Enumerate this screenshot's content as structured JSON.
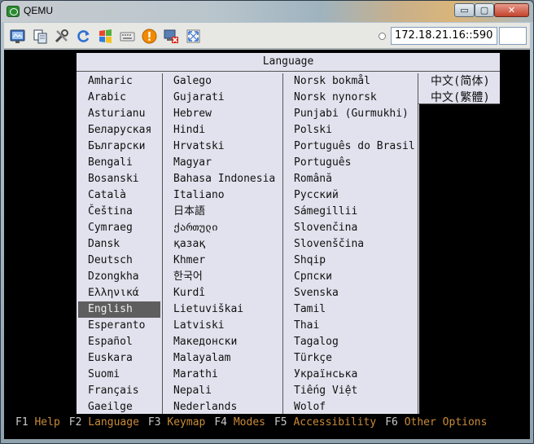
{
  "window": {
    "title": "QEMU",
    "controls": {
      "minimize": "▭",
      "maximize": "▢",
      "close": "✕"
    }
  },
  "toolbar": {
    "icons": [
      "monitor-icon",
      "copy-icon",
      "tools-icon",
      "refresh-icon",
      "windows-flag-icon",
      "keyboard-icon",
      "alert-icon",
      "disconnect-icon",
      "fullscreen-icon"
    ],
    "address": "172.18.21.16::590",
    "colors": {
      "alert": "#f28a00",
      "refresh": "#2f6fd1"
    }
  },
  "dialog": {
    "title": "Language",
    "columns": [
      [
        "Amharic",
        "Arabic",
        "Asturianu",
        "Беларуская",
        "Български",
        "Bengali",
        "Bosanski",
        "Català",
        "Čeština",
        "Cymraeg",
        "Dansk",
        "Deutsch",
        "Dzongkha",
        "Ελληνικά",
        "English",
        "Esperanto",
        "Español",
        "Euskara",
        "Suomi",
        "Français",
        "Gaeilge"
      ],
      [
        "Galego",
        "Gujarati",
        "Hebrew",
        "Hindi",
        "Hrvatski",
        "Magyar",
        "Bahasa Indonesia",
        "Italiano",
        "日本語",
        "ქართული",
        "қазақ",
        "Khmer",
        "한국어",
        "Kurdî",
        "Lietuviškai",
        "Latviski",
        "Македонски",
        "Malayalam",
        "Marathi",
        "Nepali",
        "Nederlands"
      ],
      [
        "Norsk bokmål",
        "Norsk nynorsk",
        "Punjabi (Gurmukhi)",
        "Polski",
        "Português do Brasil",
        "Português",
        "Română",
        "Русский",
        "Sámegillii",
        "Slovenčina",
        "Slovenščina",
        "Shqip",
        "Српски",
        "Svenska",
        "Tamil",
        "Thai",
        "Tagalog",
        "Türkçe",
        "Українська",
        "Tiếng Việt",
        "Wolof"
      ],
      [
        "中文(简体)",
        "中文(繁體)"
      ]
    ],
    "selected": "English",
    "colors": {
      "background": "#e2e2ee",
      "selected": "#5e5e5e"
    }
  },
  "function_keys": [
    {
      "key": "F1",
      "label": "Help"
    },
    {
      "key": "F2",
      "label": "Language"
    },
    {
      "key": "F3",
      "label": "Keymap"
    },
    {
      "key": "F4",
      "label": "Modes"
    },
    {
      "key": "F5",
      "label": "Accessibility"
    },
    {
      "key": "F6",
      "label": "Other Options"
    }
  ]
}
